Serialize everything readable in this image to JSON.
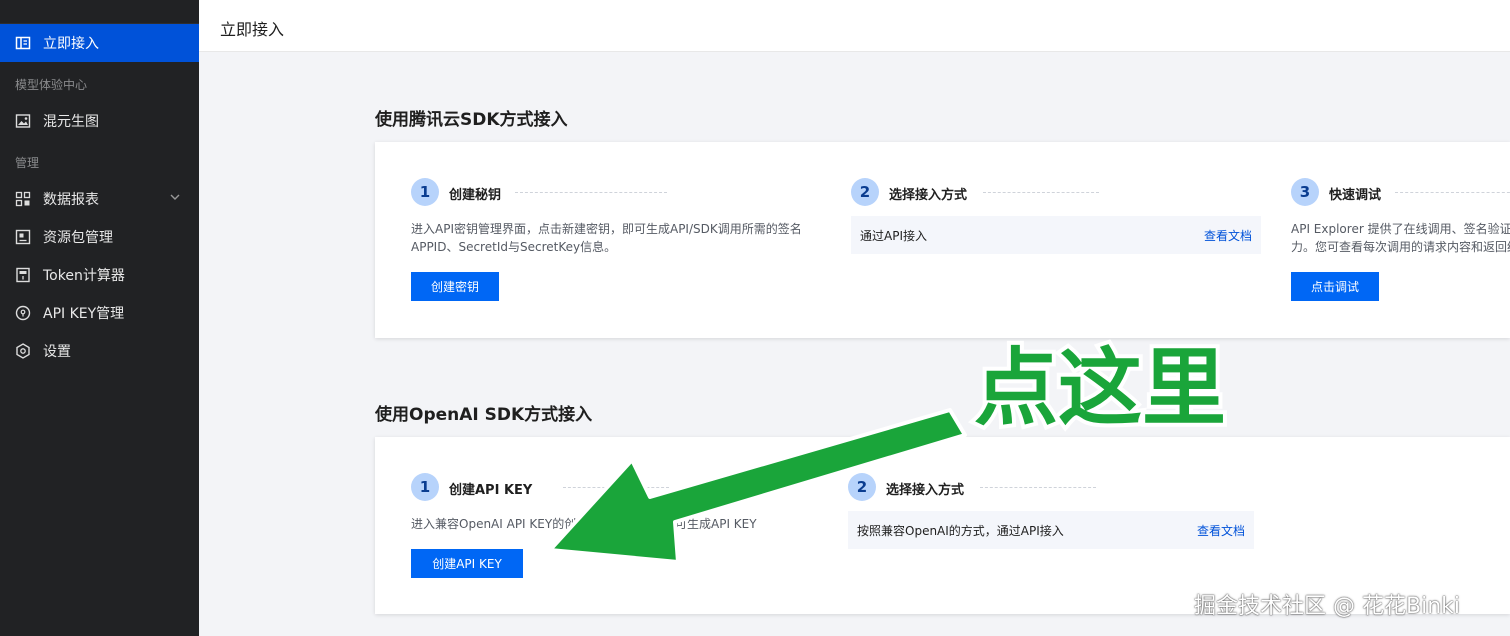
{
  "sidebar": {
    "active_item": "立即接入",
    "section_models": "模型体验中心",
    "item_hunyuan": "混元生图",
    "section_manage": "管理",
    "item_reports": "数据报表",
    "item_packages": "资源包管理",
    "item_token": "Token计算器",
    "item_apikey": "API KEY管理",
    "item_settings": "设置"
  },
  "header": {
    "title": "立即接入"
  },
  "tencent_sdk": {
    "title": "使用腾讯云SDK方式接入",
    "step1": {
      "num": "1",
      "label": "创建秘钥",
      "desc_line1": "进入API密钥管理界面，点击新建密钥，即可生成API/SDK调用所需的签名",
      "desc_line2": "APPID、SecretId与SecretKey信息。",
      "button": "创建密钥"
    },
    "step2": {
      "num": "2",
      "label": "选择接入方式",
      "box_text": "通过API接入",
      "box_link": "查看文档"
    },
    "step3": {
      "num": "3",
      "label": "快速调试",
      "desc_line1": "API Explorer 提供了在线调用、签名验证、",
      "desc_line2": "力。您可查看每次调用的请求内容和返回结",
      "button": "点击调试"
    }
  },
  "openai_sdk": {
    "title": "使用OpenAI SDK方式接入",
    "step1": {
      "num": "1",
      "label": "创建API KEY",
      "desc_left": "进入兼容OpenAI API KEY的创",
      "desc_right": "可生成API KEY",
      "button": "创建API KEY"
    },
    "step2": {
      "num": "2",
      "label": "选择接入方式",
      "box_text": "按照兼容OpenAI的方式，通过API接入",
      "box_link": "查看文档"
    }
  },
  "annotation": {
    "text": "点这里",
    "color": "#1aa53a"
  },
  "watermark": "掘金技术社区 @ 花花Binki",
  "colors": {
    "accent": "#0067f5",
    "sidebar_bg": "#212224",
    "active_nav": "#0052d9"
  }
}
